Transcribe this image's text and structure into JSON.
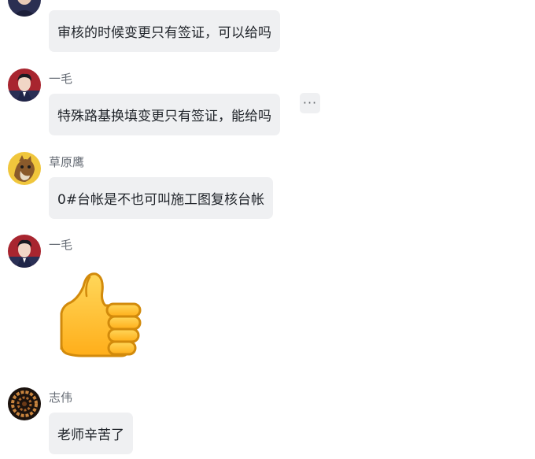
{
  "messages": [
    {
      "sender": "",
      "text": "审核的时候变更只有签证，可以给吗"
    },
    {
      "sender": "一毛",
      "text": "特殊路基换填变更只有签证，能给吗"
    },
    {
      "sender": "草原鹰",
      "text": "0#台帐是不也可叫施工图复核台帐"
    },
    {
      "sender": "一毛",
      "sticker": "thumbs-up"
    },
    {
      "sender": "志伟",
      "text": "老师辛苦了"
    }
  ],
  "more_button": {
    "label": "···"
  },
  "colors": {
    "bubble_bg": "#eff0f2",
    "sender_text": "#646a73",
    "message_text": "#1f2329"
  }
}
